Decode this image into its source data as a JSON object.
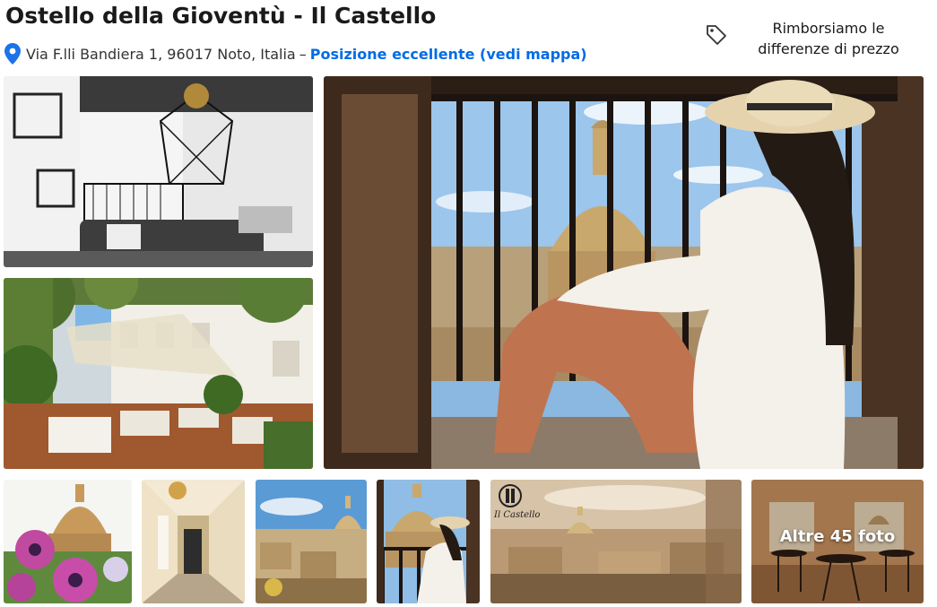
{
  "header": {
    "title": "Ostello della Gioventù - Il Castello",
    "address": "Via F.lli Bandiera 1, 96017 Noto, Italia",
    "separator": "–",
    "location_link": "Posizione eccellente (vedi mappa)",
    "price_match": "Rimborsiamo le differenze di prezzo"
  },
  "gallery": {
    "more_photos_label": "Altre 45 foto",
    "photo_logo_text": "Il Castello"
  },
  "colors": {
    "link": "#006ce4",
    "pin": "#1a73e8",
    "text": "#1a1a1a"
  },
  "icons": [
    "map-pin-icon",
    "price-tag-icon"
  ]
}
